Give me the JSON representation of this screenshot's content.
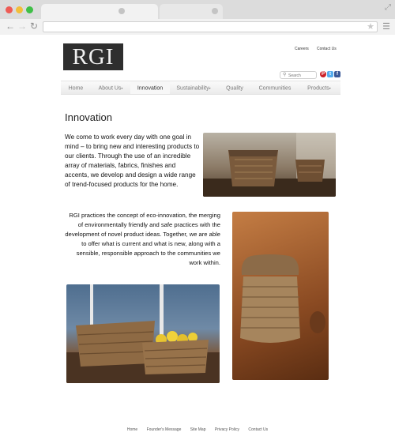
{
  "header": {
    "logo_text": "RGI",
    "util_links": [
      "Careers",
      "Contact Us"
    ],
    "search_placeholder": "Search"
  },
  "social": [
    "P",
    "t",
    "f"
  ],
  "nav": [
    {
      "label": "Home",
      "caret": ""
    },
    {
      "label": "About Us",
      "caret": "▾"
    },
    {
      "label": "Innovation",
      "caret": ""
    },
    {
      "label": "Sustainability",
      "caret": "▾"
    },
    {
      "label": "Quality",
      "caret": ""
    },
    {
      "label": "Communities",
      "caret": ""
    },
    {
      "label": "Products",
      "caret": "▾"
    }
  ],
  "page": {
    "title": "Innovation",
    "para1": "We come to work every day with one goal in mind – to bring new and interesting products to our clients. Through the use of an incredible array of materials, fabrics, finishes and accents, we develop and design a wide range of trend-focused products for the home.",
    "para2": "RGI practices the concept of eco-innovation, the merging of environmentally friendly and safe practices with the development of novel product ideas. Together, we are able to offer what is current and what is new, along with a sensible, responsible approach to the communities we work within."
  },
  "footer": [
    "Home",
    "Founder's Message",
    "Site Map",
    "Privacy Policy",
    "Contact Us"
  ]
}
